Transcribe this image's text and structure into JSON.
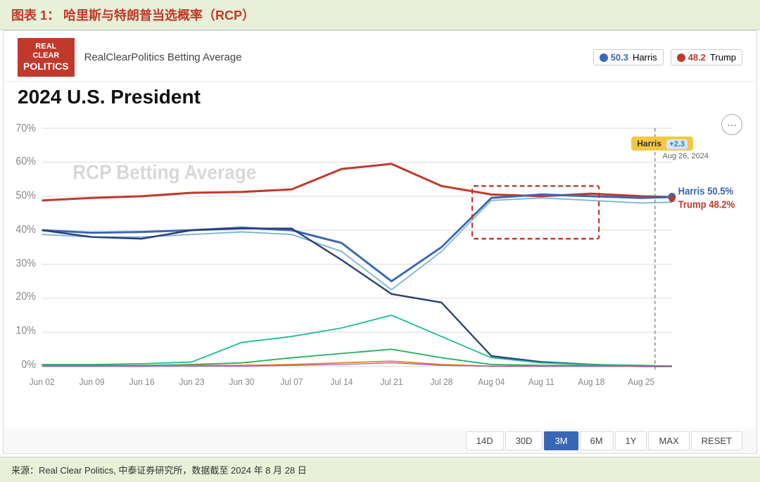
{
  "title_bar": {
    "text": "图表 1：  哈里斯与特朗普当选概率（RCP）"
  },
  "logo": {
    "line1": "REAL",
    "line2": "CLEAR",
    "line3": "POLITICS"
  },
  "header": {
    "subtitle": "RealClearPolitics Betting Average",
    "chart_title": "2024 U.S. President"
  },
  "legend": {
    "harris_score": "50.3",
    "harris_label": "Harris",
    "trump_score": "48.2",
    "trump_label": "Trump"
  },
  "chart": {
    "watermark": "RCP Betting Average",
    "harris_badge": "Harris",
    "harris_diff": "+2.3",
    "date_badge": "Aug 26, 2024",
    "harris_final": "Harris 50.5%",
    "trump_final": "Trump 48.2%",
    "y_labels": [
      "70%",
      "60%",
      "50%",
      "40%",
      "30%",
      "20%",
      "10%",
      "0%"
    ],
    "x_labels": [
      "Jun 02",
      "Jun 09",
      "Jun 16",
      "Jun 23",
      "Jun 30",
      "Jul 07",
      "Jul 14",
      "Jul 21",
      "Jul 28",
      "Aug 04",
      "Aug 11",
      "Aug 18",
      "Aug 25"
    ]
  },
  "time_controls": {
    "buttons": [
      "14D",
      "30D",
      "3M",
      "6M",
      "1Y",
      "MAX",
      "RESET"
    ],
    "active": "3M"
  },
  "footer": {
    "text": "来源：Real Clear Politics, 中泰证券研究所，数据截至 2024 年 8 月 28 日"
  }
}
